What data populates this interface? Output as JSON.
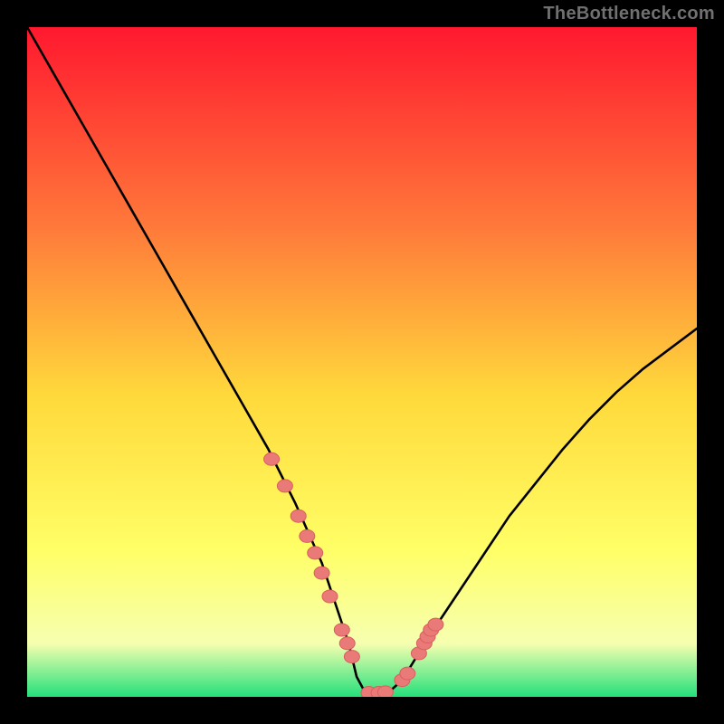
{
  "watermark": "TheBottleneck.com",
  "colors": {
    "bg": "#000000",
    "grad_top": "#ff182f",
    "grad_mid1": "#ff7a3a",
    "grad_mid2": "#ffd93b",
    "grad_mid3": "#ffff66",
    "grad_low": "#f6ffb0",
    "grad_bottom": "#24e07b",
    "curve": "#000000",
    "marker_fill": "#e97a78",
    "marker_stroke": "#d85f5d",
    "watermark": "#707070"
  },
  "chart_data": {
    "type": "line",
    "title": "",
    "xlabel": "",
    "ylabel": "",
    "xlim": [
      0,
      100
    ],
    "ylim": [
      0,
      100
    ],
    "grid": false,
    "series": [
      {
        "name": "bottleneck-curve",
        "x": [
          0,
          4,
          8,
          12,
          16,
          20,
          24,
          28,
          32,
          36,
          40,
          44,
          48,
          49.2,
          50.5,
          52,
          54,
          56,
          60,
          64,
          68,
          72,
          76,
          80,
          84,
          88,
          92,
          96,
          100
        ],
        "y": [
          100,
          93,
          86,
          79,
          72,
          65,
          58,
          51,
          44,
          37,
          29,
          20,
          8,
          3,
          0.6,
          0.6,
          0.7,
          2.5,
          9,
          15,
          21,
          27,
          32,
          37,
          41.5,
          45.5,
          49,
          52,
          55
        ]
      }
    ],
    "markers": {
      "name": "highlight-points",
      "x": [
        36.5,
        38.5,
        40.5,
        41.8,
        43,
        44,
        45.2,
        47,
        47.8,
        48.5,
        51,
        52.5,
        53.5,
        56,
        56.8,
        58.5,
        59.3,
        59.8,
        60.3,
        61
      ],
      "y": [
        35.5,
        31.5,
        27,
        24,
        21.5,
        18.5,
        15,
        10,
        8,
        6,
        0.6,
        0.6,
        0.7,
        2.5,
        3.5,
        6.5,
        8,
        9,
        10,
        10.8
      ]
    }
  }
}
